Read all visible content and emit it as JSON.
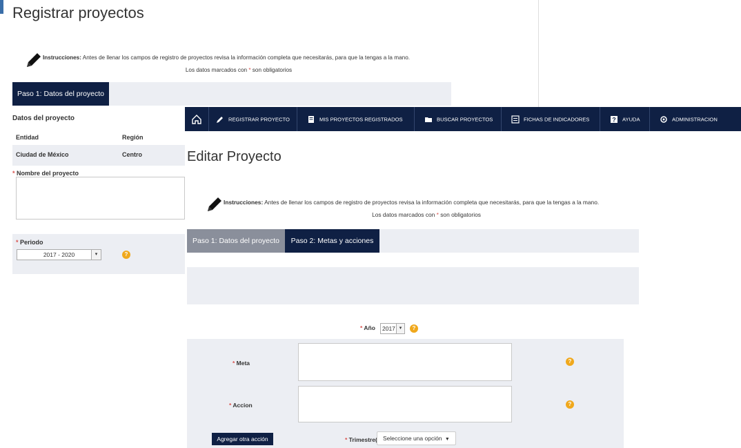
{
  "background_form": {
    "title": "Registrar proyectos",
    "instructions": {
      "bold": "Instrucciones:",
      "text": " Antes de llenar los campos de registro de proyectos revisa la información completa que necesitarás, para que la tengas a la mano.",
      "required_prefix": "Los datos marcados con ",
      "required_mark": "*",
      "required_suffix": " son obligatorios"
    },
    "steps": [
      "Paso 1: Datos del proyecto"
    ],
    "section_title": "Datos del proyecto",
    "entity_label": "Entidad",
    "region_label": "Región",
    "entity_value": "Ciudad de México",
    "region_value": "Centro",
    "name_label": "Nombre del proyecto",
    "period_label": "Periodo",
    "period_value": "2017 - 2020",
    "help_icon": "?"
  },
  "navbar": {
    "items": [
      {
        "label": "",
        "icon": "home-icon"
      },
      {
        "label": "REGISTRAR PROYECTO",
        "icon": "pencil-icon"
      },
      {
        "label": "MIS PROYECTOS REGISTRADOS",
        "icon": "document-icon"
      },
      {
        "label": "BUSCAR PROYECTOS",
        "icon": "folder-icon"
      },
      {
        "label": "FICHAS DE INDICADORES",
        "icon": "list-icon"
      },
      {
        "label": "AYUDA",
        "icon": "help-icon"
      },
      {
        "label": "ADMINISTRACION",
        "icon": "admin-icon"
      }
    ]
  },
  "edit_form": {
    "title": "Editar Proyecto",
    "instructions": {
      "bold": "Instrucciones:",
      "text": " Antes de llenar los campos de registro de proyectos revisa la información completa que necesitarás, para que la tengas a la mano.",
      "required_prefix": "Los datos marcados con ",
      "required_mark": "*",
      "required_suffix": " son obligatorios"
    },
    "steps": [
      "Paso 1: Datos del proyecto",
      "Paso 2: Metas y acciones"
    ],
    "year_label": "Año",
    "year_value": "2017",
    "meta_label": "Meta",
    "accion_label": "Accion",
    "add_action_button": "Agregar otra acción",
    "trimestre_label": "Trimestre(s)",
    "trimestre_placeholder": "Seleccione una opción",
    "help_icon": "?"
  },
  "colors": {
    "navy": "#0f2044",
    "panel_gray": "#eceef3",
    "help_orange": "#f0a81c",
    "required_red": "#d9534f"
  }
}
